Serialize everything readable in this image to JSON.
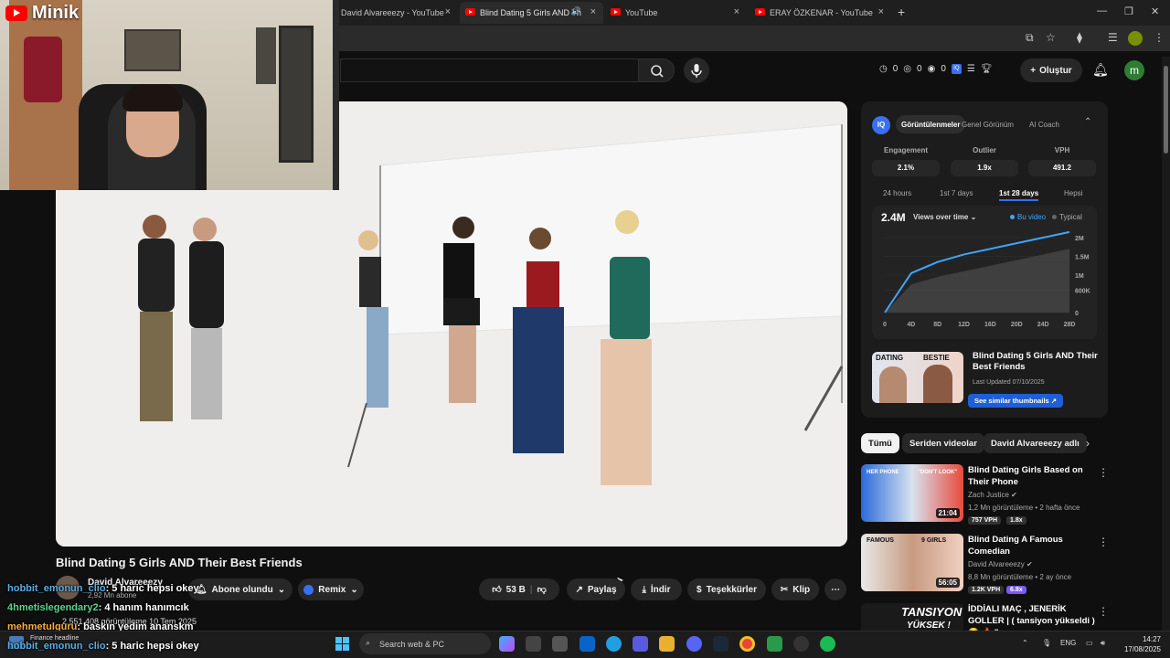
{
  "browser": {
    "tabs": [
      {
        "label": "David Alvareeezy - YouTube",
        "active": false
      },
      {
        "label": "Blind Dating 5 Girls AND Th",
        "active": true
      },
      {
        "label": "YouTube",
        "active": false
      },
      {
        "label": "ERAY ÖZKENAR - YouTube",
        "active": false
      }
    ],
    "new_tab": "+",
    "close": "×"
  },
  "overlay": {
    "channel_tag": "Minik"
  },
  "header": {
    "stats": [
      "0",
      "0",
      "0"
    ],
    "iq": "IQ",
    "create_label": "Oluştur",
    "avatar_letter": "m"
  },
  "video": {
    "title": "Blind Dating 5 Girls AND Their Best Friends",
    "channel": "David Alvareeezy",
    "subs": "2,92 Mn abone",
    "subscribe_label": "Abone olundu",
    "remix_label": "Remix",
    "likes": "53 B",
    "share_label": "Paylaş",
    "download_label": "İndir",
    "thanks_label": "Teşekkürler",
    "clip_label": "Klip",
    "views": "2.551.408 görüntüleme  10 Tem 2025"
  },
  "chat": [
    {
      "user": "hobbit_emonun_clio",
      "msg": ": 5 haric hepsi okey"
    },
    {
      "user": "4hmetislegendary2",
      "msg": ": 4 hanım hanımcık"
    },
    {
      "user": "mehmetulguru",
      "msg": ": baskın yedim ananskm"
    },
    {
      "user": "hobbit_emonun_clio",
      "msg": ": 5 haric hepsi okey"
    }
  ],
  "panel": {
    "iq": "IQ",
    "tabs": [
      "Görüntülenmeler",
      "Genel Görünüm",
      "AI Coach"
    ],
    "metrics": [
      {
        "label": "Engagement",
        "value": "2.1%"
      },
      {
        "label": "Outlier",
        "value": "1.9x"
      },
      {
        "label": "VPH",
        "value": "491.2"
      }
    ],
    "periods": [
      "24 hours",
      "1st 7 days",
      "1st 28 days",
      "Hepsi"
    ],
    "active_period": "1st 28 days",
    "total": "2.4M",
    "metric_select": "Views over time",
    "legend": [
      {
        "name": "Bu video",
        "color": "#3ea6ff"
      },
      {
        "name": "Typical",
        "color": "#555555"
      }
    ],
    "related": {
      "thumb_left": "DATING",
      "thumb_right": "BESTIE",
      "title": "Blind Dating 5 Girls AND Their Best Friends",
      "updated": "Last Updated 07/10/2025",
      "button": "See similar thumbnails ↗"
    }
  },
  "chart_data": {
    "type": "line",
    "x": [
      "0",
      "4D",
      "8D",
      "12D",
      "16D",
      "20D",
      "24D",
      "28D"
    ],
    "y_ticks": [
      "0",
      "600K",
      "1M",
      "1.5M",
      "2M"
    ],
    "ylim": [
      0,
      2000000
    ],
    "series": [
      {
        "name": "Bu video",
        "values": [
          0,
          1050000,
          1350000,
          1550000,
          1700000,
          1850000,
          2000000,
          2150000
        ]
      },
      {
        "name": "Typical",
        "values": [
          0,
          750000,
          950000,
          1100000,
          1250000,
          1400000,
          1550000,
          1700000
        ]
      }
    ]
  },
  "chips": [
    "Tümü",
    "Seriden videolar",
    "David Alvareeezy adlı"
  ],
  "recommendations": [
    {
      "title": "Blind Dating Girls Based on Their Phone",
      "channel": "Zach Justice",
      "meta": "1,2 Mn görüntüleme • 2 hafta önce",
      "vph": "757 VPH",
      "ratio": "1.8x",
      "duration": "21:04",
      "thumb_text_l": "HER PHONE",
      "thumb_text_r": "\"DON'T LOOK\""
    },
    {
      "title": "Blind Dating A Famous Comedian",
      "channel": "David Alvareeezy",
      "meta": "8,8 Mn görüntüleme • 2 ay önce",
      "vph": "1.2K VPH",
      "ratio": "6.8x",
      "duration": "56:05",
      "thumb_text_l": "FAMOUS",
      "thumb_text_r": "9 GIRLS"
    },
    {
      "title": "İDDİALI MAÇ , JENERİK GOLLER | ( tansiyon yükseldi ) 😂 🔥 \"",
      "channel": "",
      "meta": "",
      "vph": "",
      "ratio": "",
      "duration": "",
      "thumb_text_l": "TANSIYON",
      "thumb_text_r": "YÜKSEK !"
    }
  ],
  "taskbar": {
    "finance": "Finance headline",
    "search": "Search web & PC",
    "lang": "ENG",
    "time": "14:27",
    "date": "17/08/2025"
  }
}
